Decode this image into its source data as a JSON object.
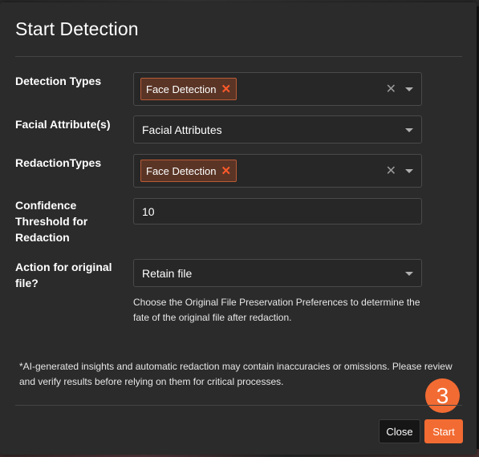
{
  "dialog": {
    "title": "Start Detection",
    "detection_types": {
      "label": "Detection Types",
      "selected_chip": "Face Detection",
      "chip_remove_glyph": "✕",
      "clear_glyph": "✕"
    },
    "facial_attributes": {
      "label": "Facial Attribute(s)",
      "value": "Facial Attributes"
    },
    "redaction_types": {
      "label": "RedactionTypes",
      "selected_chip": "Face Detection",
      "chip_remove_glyph": "✕",
      "clear_glyph": "✕"
    },
    "confidence_threshold": {
      "label": "Confidence Threshold for Redaction",
      "value": "10"
    },
    "original_file_action": {
      "label": "Action for original file?",
      "value": "Retain file",
      "help_text": "Choose the Original File Preservation Preferences to determine the fate of the original file after redaction."
    },
    "disclaimer": "*AI-generated insights and automatic redaction may contain inaccuracies or omissions. Please review and verify results before relying on them for critical processes.",
    "step_badge": "3",
    "close_label": "Close",
    "start_label": "Start"
  },
  "colors": {
    "accent": "#f26b32",
    "chip_bg": "#5a3526",
    "modal_bg": "#2b2b2b"
  },
  "icons": {
    "dropdown": "caret-down-icon",
    "clear": "clear-icon",
    "chip_remove": "remove-chip-icon"
  }
}
